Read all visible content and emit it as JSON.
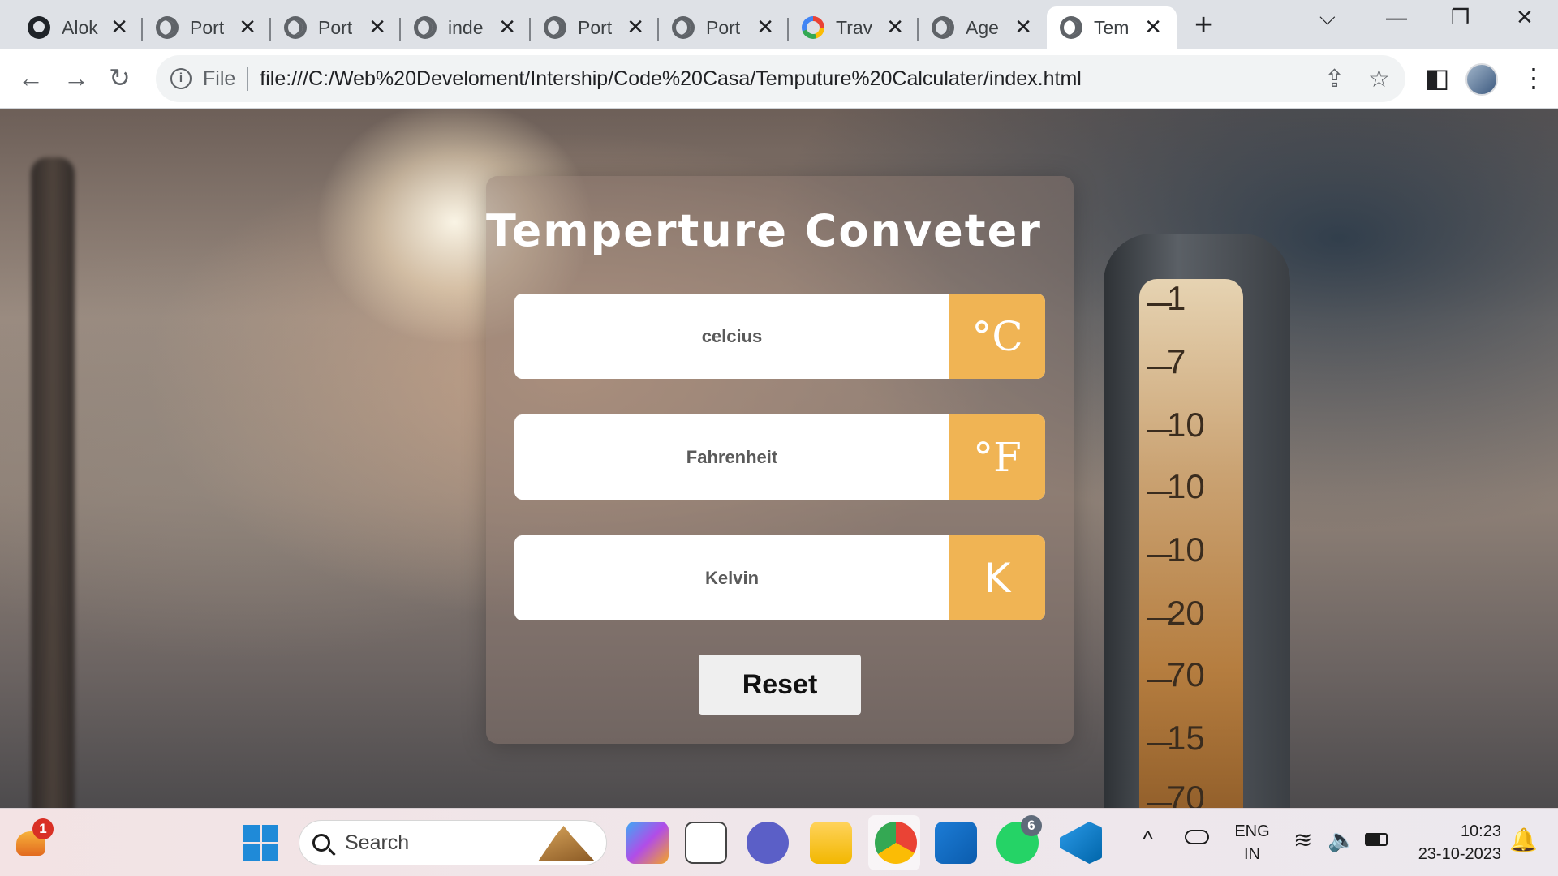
{
  "browser": {
    "tabs": [
      {
        "title": "Alok",
        "favicon": "github-icon",
        "active": false
      },
      {
        "title": "Port",
        "favicon": "globe-icon",
        "active": false
      },
      {
        "title": "Port",
        "favicon": "globe-icon",
        "active": false
      },
      {
        "title": "inde",
        "favicon": "globe-icon",
        "active": false
      },
      {
        "title": "Port",
        "favicon": "globe-icon",
        "active": false
      },
      {
        "title": "Port",
        "favicon": "globe-icon",
        "active": false
      },
      {
        "title": "Trav",
        "favicon": "google-icon",
        "active": false
      },
      {
        "title": "Age",
        "favicon": "globe-icon",
        "active": false
      },
      {
        "title": "Tem",
        "favicon": "globe-icon",
        "active": true
      }
    ],
    "address": {
      "scheme_label": "File",
      "url": "file:///C:/Web%20Develoment/Intership/Code%20Casa/Temputure%20Calculater/index.html"
    }
  },
  "page": {
    "title": "Temperture Conveter 🌡",
    "celsius": {
      "placeholder": "celcius",
      "unit": "°C"
    },
    "fahrenheit": {
      "placeholder": "Fahrenheit",
      "unit": "°F"
    },
    "kelvin": {
      "placeholder": "Kelvin",
      "unit": "K"
    },
    "reset_label": "Reset",
    "background_scale": [
      "1",
      "7",
      "10",
      "10",
      "10",
      "20",
      "70",
      "15",
      "70"
    ]
  },
  "taskbar": {
    "search_label": "Search",
    "notification_badge": "1",
    "whatsapp_badge": "6",
    "language": {
      "line1": "ENG",
      "line2": "IN"
    },
    "time": "10:23",
    "date": "23-10-2023"
  },
  "colors": {
    "unit_accent": "#f0b454",
    "card_text": "#ffffff",
    "active_tab": "#ffffff"
  }
}
